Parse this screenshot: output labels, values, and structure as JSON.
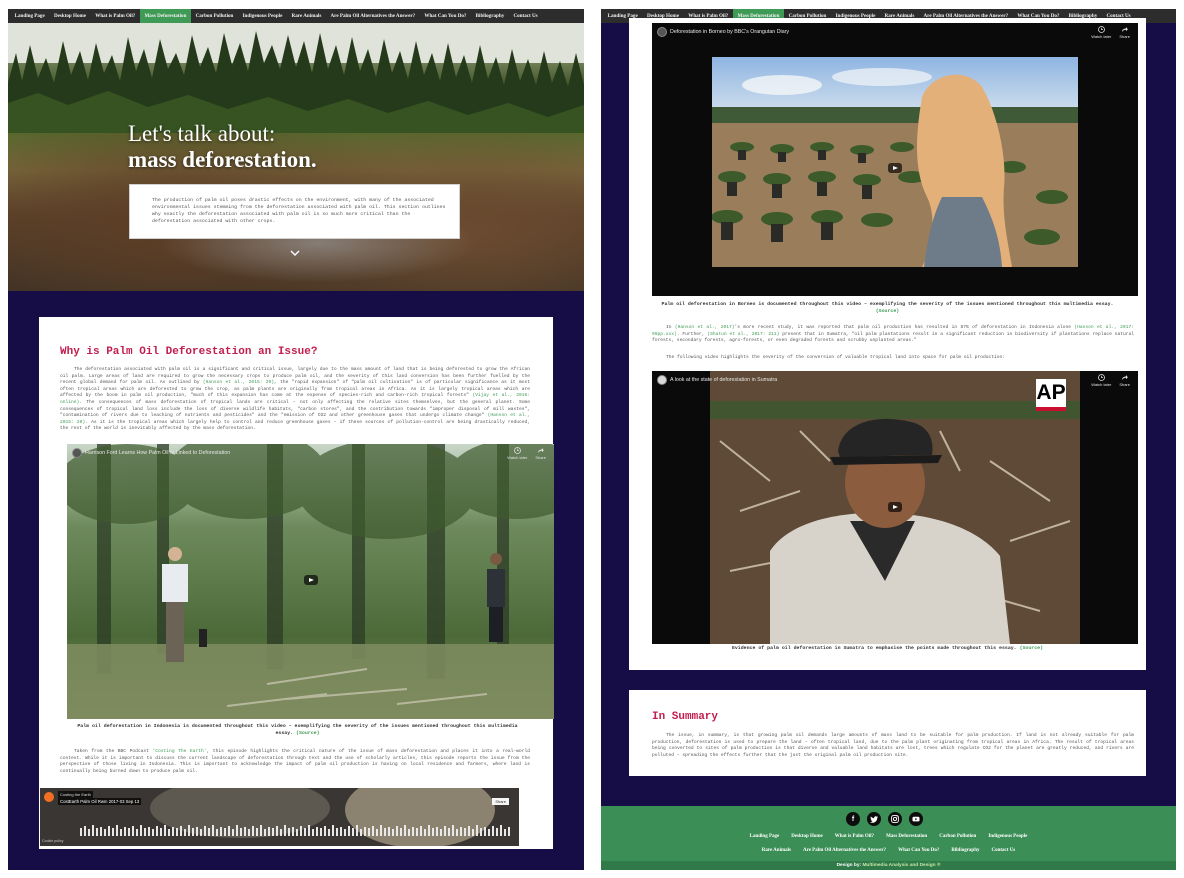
{
  "nav": {
    "items": [
      "Landing Page",
      "Desktop Home",
      "What is Palm Oil?",
      "Mass Deforestation",
      "Carbon Pollution",
      "Indigenous People",
      "Rare Animals",
      "Are Palm Oil Alternatives the Answer?",
      "What Can You Do?",
      "Bibliography",
      "Contact Us"
    ],
    "active": "Mass Deforestation"
  },
  "hero": {
    "title_line1": "Let's talk about:",
    "title_line2": "mass deforestation.",
    "intro": "The production of palm oil poses drastic effects on the environment, with many of the associated environmental issues stemming from the deforestation associated with palm oil. This section outlines why exactly the deforestation associated with palm oil is so much more critical than the deforestation associated with other crops."
  },
  "main": {
    "heading": "Why is Palm Oil Deforestation an Issue?",
    "para1_a": "The deforestation associated with palm oil is a significant and critical issue, largely due to the mass amount of land that is being deforested to grow the African oil palm. Large areas of land are required to grow the necessary crops to produce palm oil, and the severity of this land conversion has been further fuelled by the recent global demand for palm oil. As outlined by",
    "cite1": "(Hanson et al., 2015: 20)",
    "para1_b": ", the \"rapid expansion\" of \"palm oil cultivation\" is of particular significance as it most often tropical areas which are deforested to grow the crop, as palm plants are originally from tropical areas in Africa. As it is largely tropical areas which are affected by the boom in palm oil production, \"much of this expansion has come at the expense of species-rich and carbon-rich tropical forests\"",
    "cite2": "(Vijay et al., 2016: online)",
    "para1_c": ". The consequences of mass deforestation of tropical lands are critical – not only affecting the relative sites themselves, but the general planet. Some consequences of tropical land loss include the loss of diverse wildlife habitats, \"carbon stores\", and the contribution towards \"improper disposal of mill wastes\", \"contamination of rivers due to leaching of nutrients and pesticides\" and the \"emission of CO2 and other greenhouse gases that undergo climate change\"",
    "cite3": "(Hanson et al., 2015: 20)",
    "para1_d": ". As it is the tropical areas which largely help to control and reduce greenhouse gases – if these sources of pollution-control are being drastically reduced, the rest of the world is inevitably affected by the mass deforestation.",
    "video1_title": "Harrison Ford Learns How Palm Oil Is Linked to Deforestation",
    "video1_actions": [
      "Watch later",
      "Share"
    ],
    "caption1": "Palm oil deforestation in Indonesia is documented throughout this video – exemplifying the severity of the issues mentioned throughout this multimedia essay.",
    "caption1_source": "(Source)",
    "para2_a": "Taken from the BBC Podcast",
    "para2_link": "'Costing The Earth'",
    "para2_b": ", this episode highlights the critical nature of the issue of mass deforestation and places it into a real-world context. While it is important to discuss the current landscape of deforestation through text and the use of scholarly articles, this episode reports the issue from the perspective of those living in Indonesia. This is important to acknowledge the impact of palm oil production is having on local residence and farmers, where land is continually being burned down to produce palm oil.",
    "audio_title": "Costing the Earth",
    "audio_sub": "CostEarth Palm Oil Rwm 2017-03 Sep 13",
    "audio_share": "Share",
    "audio_cookie": "Cookie policy"
  },
  "right": {
    "video2_title": "Deforestation in Borneo by BBC's Orangutan Diary",
    "video2_actions": [
      "Watch later",
      "Share"
    ],
    "caption2": "Palm oil deforestation in Borneo is documented throughout this video – exemplifying the severity of the issues mentioned throughout this multimedia essay.",
    "caption2_source": "(Source)",
    "para3_a": "In",
    "cite4": "(Hanson et al., 2017)",
    "para3_b": "'s more recent study, it was reported that palm oil production has resulted in 87% of deforestation in Indonesia alone",
    "cite5": "(Hanson et al., 2017: 99pp.xxx)",
    "para3_c": ". Further,",
    "cite6": "(Shatun et al., 2017: 211)",
    "para3_d": " present that in Sumatra, \"oil palm plantations result in a significant reduction in biodiversity if plantations replace natural forests, secondary forests, agro-forests, or even degraded forests and scrubby unplanted areas.\"",
    "para4": "The following video highlights the severity of the conversion of valuable tropical land into space for palm oil production:",
    "video3_title": "A look at the state of deforestation in Sumatra",
    "video3_badge": "AP",
    "video3_actions": [
      "Watch later",
      "Share"
    ],
    "caption3": "Evidence of palm oil deforestation in Sumatra to emphasise the points made throughout this essay.",
    "caption3_source": "(Source)",
    "summary_heading": "In Summary",
    "summary_text": "The issue, in summary, is that growing palm oil demands large amounts of mass land to be suitable for palm production. If land is not already suitable for palm production, deforestation is used to prepare the land – often tropical land, due to the palm plant originating from tropical areas in Africa. The result of tropical areas being converted to sites of palm production is that diverse and valuable land habitats are lost, trees which regulate CO2 for the planet are greatly reduced, and rivers are polluted – spreading the effects further that the just the original palm oil production site."
  },
  "footer": {
    "social": [
      "f",
      "t",
      "ig",
      "yt"
    ],
    "row1": [
      "Landing Page",
      "Desktop Home",
      "What is Palm Oil?",
      "Mass Deforestation",
      "Carbon Pollution",
      "Indigenous People"
    ],
    "row2": [
      "Rare Animals",
      "Are Palm Oil Alternatives the Answer?",
      "What Can You Do?",
      "Bibliography",
      "Contact Us"
    ],
    "credit_prefix": "Design by:",
    "credit_link": "Multimedia Analysis and Design ®"
  },
  "colors": {
    "nav_bg": "#2d2d2d",
    "active": "#3f9a55",
    "page_bg": "#160d47",
    "heading": "#c21d4e",
    "footer": "#3b8e56"
  }
}
